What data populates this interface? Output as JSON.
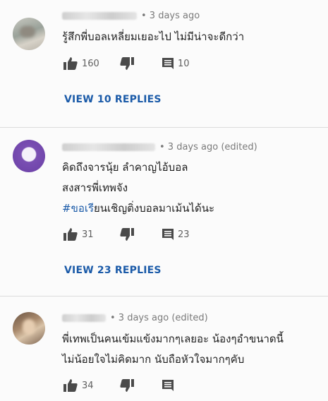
{
  "comments": [
    {
      "time": "• 3 days ago",
      "lines": [
        "รู้สึกพี่บอลเหลี่ยมเยอะไป ไม่มีน่าจะดีกว่า"
      ],
      "likes": "160",
      "replies_count": "10",
      "view_replies": "VIEW 10 REPLIES"
    },
    {
      "time": "• 3 days ago (edited)",
      "lines": [
        "คิดถึงจารนุ้ย ลำคาญไอ้บอล",
        "สงสารพี่เทพจัง"
      ],
      "hashtag_prefix": "#ขอเรี",
      "hashtag_rest": "ยนเชิญติ่งบอลมาเม้นได้นะ",
      "likes": "31",
      "replies_count": "23",
      "view_replies": "VIEW 23 REPLIES"
    },
    {
      "time": "• 3 days ago (edited)",
      "lines": [
        "พี่เทพเป็นคนเข้มแข้งมากๆเลยอะ น้องๆอำขนาดนี้",
        "ไม่น้อยใจไม่คิดมาก นับถือหัวใจมากๆคับ"
      ],
      "likes": "34"
    }
  ],
  "icons": {
    "like": "thumbs-up-icon",
    "dislike": "thumbs-down-icon",
    "reply": "reply-comment-icon"
  },
  "colors": {
    "link": "#1a5aa8",
    "meta": "#7a7a7a",
    "icon": "#4a4a4a"
  }
}
